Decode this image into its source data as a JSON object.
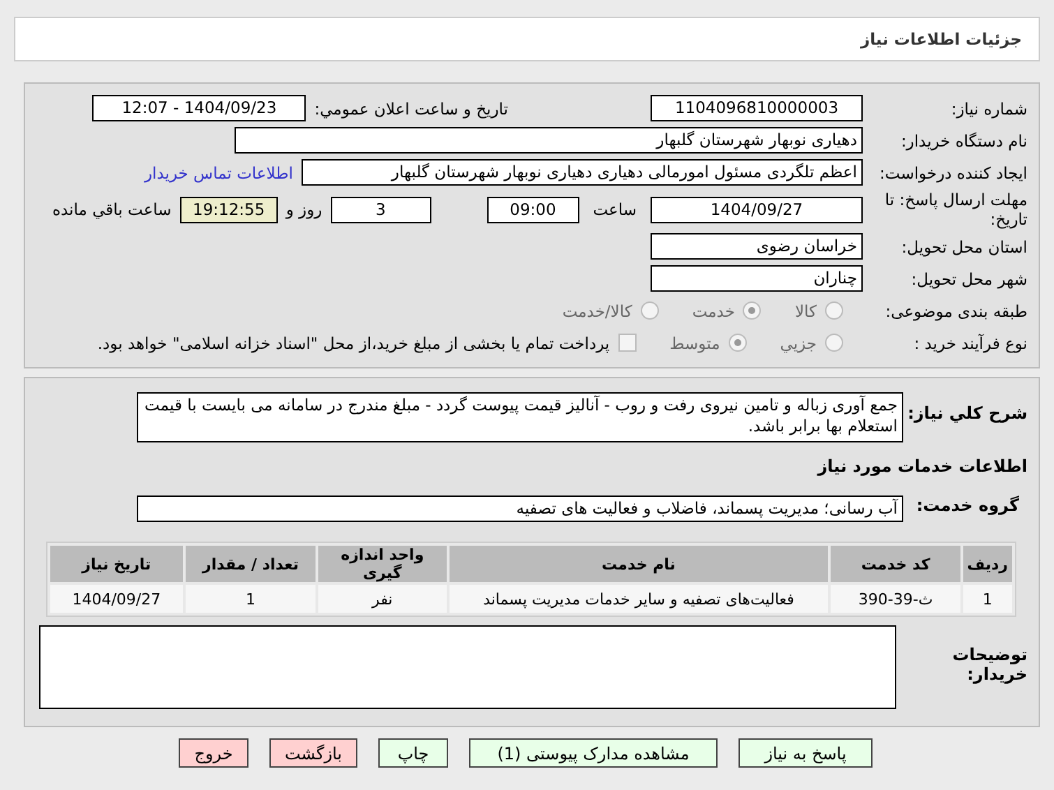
{
  "header": {
    "title": "جزئیات اطلاعات نیاز"
  },
  "need": {
    "need_number": {
      "label": "شماره نیاز:",
      "value": "1104096810000003"
    },
    "announcement": {
      "label": "تاریخ و ساعت اعلان عمومي:",
      "value": "1404/09/23 - 12:07"
    },
    "buyer": {
      "label": "نام دستگاه خریدار:",
      "value": "دهیاری نوبهار شهرستان گلبهار"
    },
    "requester": {
      "label": "ایجاد کننده درخواست:",
      "value": "اعظم تلگردی مسئول امورمالی دهیاری  دهیاری نوبهار شهرستان گلبهار",
      "link": "اطلاعات تماس خریدار"
    },
    "deadline": {
      "label": "مهلت ارسال پاسخ: تا تاریخ:",
      "date": "1404/09/27",
      "time_label": "ساعت",
      "time": "09:00",
      "days": "3",
      "days_label": "روز و",
      "remaining": "19:12:55",
      "remaining_label": "ساعت باقي مانده"
    },
    "province": {
      "label": "استان محل تحویل:",
      "value": "خراسان رضوی"
    },
    "city": {
      "label": "شهر محل تحویل:",
      "value": "چناران"
    },
    "category": {
      "label": "طبقه بندی موضوعی:",
      "options": [
        {
          "label": "کالا",
          "selected": false
        },
        {
          "label": "خدمت",
          "selected": true
        },
        {
          "label": "کالا/خدمت",
          "selected": false
        }
      ]
    },
    "process": {
      "label": "نوع فرآیند خرید :",
      "options": [
        {
          "label": "جزیي",
          "selected": false
        },
        {
          "label": "متوسط",
          "selected": true
        }
      ],
      "payment": {
        "checked": false,
        "text": "پرداخت تمام یا بخشی از مبلغ خرید،از محل \"اسناد خزانه اسلامی\" خواهد بود."
      }
    }
  },
  "services": {
    "description": {
      "label": "شرح کلي نیاز:",
      "value": "جمع آوری زباله و تامین نیروی رفت و روب - آنالیز قیمت پیوست گردد - مبلغ مندرج در سامانه می بایست با قیمت استعلام بها برابر باشد."
    },
    "heading": "اطلاعات خدمات مورد نیاز",
    "group": {
      "label": "گروه خدمت:",
      "value": "آب رسانی؛ مدیریت پسماند، فاضلاب و فعالیت های تصفیه"
    },
    "table": {
      "columns": [
        "ردیف",
        "کد خدمت",
        "نام خدمت",
        "واحد اندازه گیری",
        "تعداد / مقدار",
        "تاریخ نیاز"
      ],
      "rows": [
        [
          "1",
          "ث-39-390",
          "فعالیت‌های تصفیه و سایر خدمات مدیریت پسماند",
          "نفر",
          "1",
          "1404/09/27"
        ]
      ]
    },
    "notes": {
      "label": "توضیحات خریدار:"
    }
  },
  "buttons": [
    {
      "label": "پاسخ به نیاز",
      "kind": "normal"
    },
    {
      "label": "مشاهده مدارک پیوستی (1)",
      "kind": "normal"
    },
    {
      "label": "چاپ",
      "kind": "normal"
    },
    {
      "label": "بازگشت",
      "kind": "danger"
    },
    {
      "label": "خروج",
      "kind": "danger"
    }
  ]
}
